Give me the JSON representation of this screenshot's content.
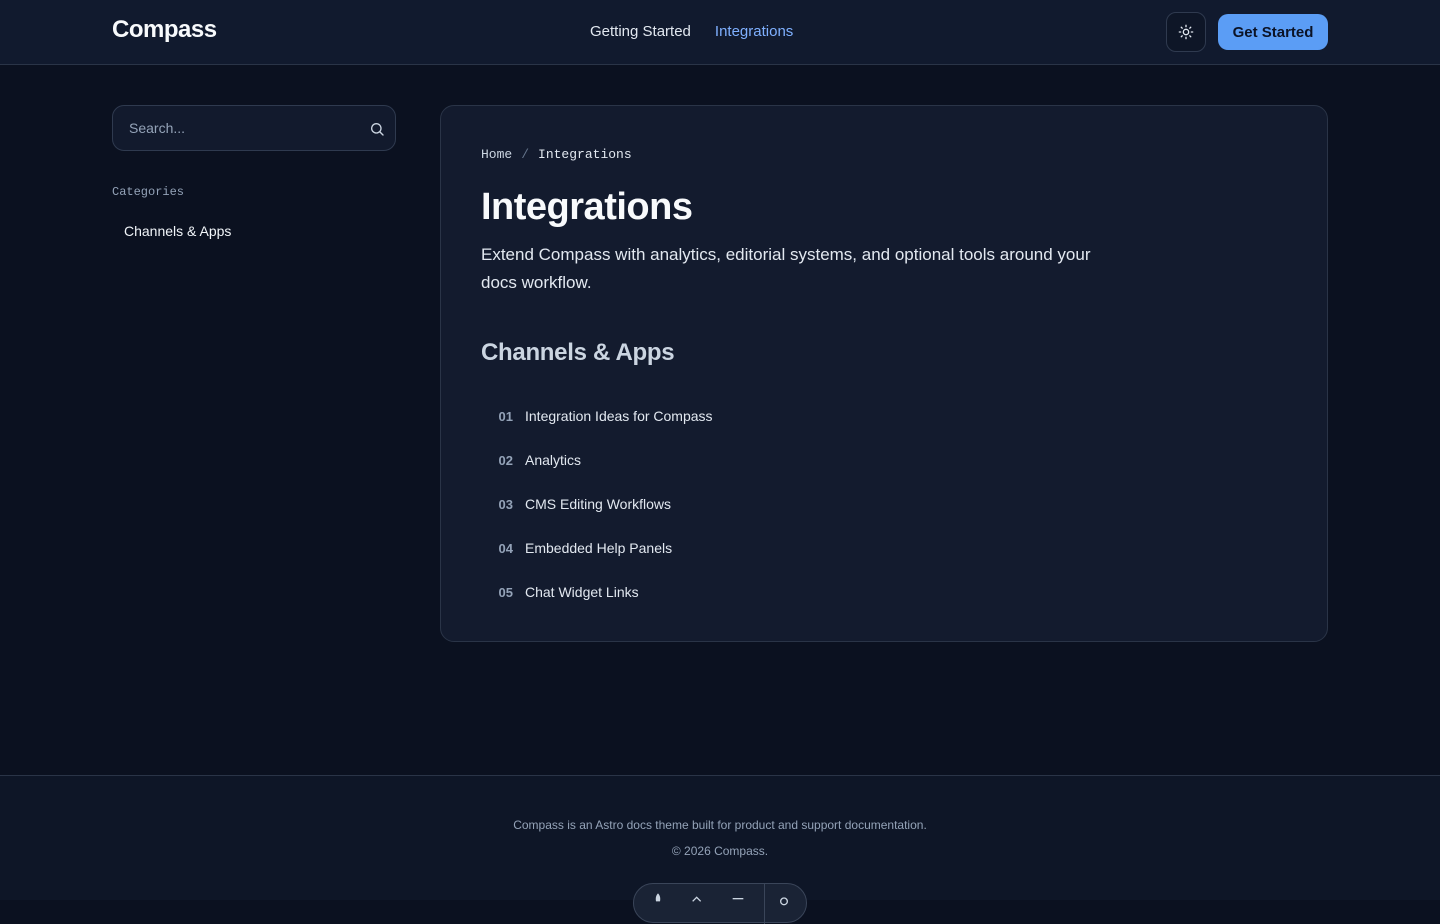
{
  "header": {
    "logo": "Compass",
    "nav": [
      {
        "label": "Getting Started",
        "active": false
      },
      {
        "label": "Integrations",
        "active": true
      }
    ],
    "theme_icon": "sun-icon",
    "cta_label": "Get Started"
  },
  "sidebar": {
    "search_placeholder": "Search...",
    "categories_label": "Categories",
    "category_item": "Channels & Apps"
  },
  "main": {
    "breadcrumb": {
      "home": "Home",
      "separator": "/",
      "current": "Integrations"
    },
    "title": "Integrations",
    "lead": "Extend Compass with analytics, editorial systems, and optional tools around your docs workflow.",
    "section_title": "Channels & Apps",
    "items": [
      {
        "num": "01",
        "label": "Integration Ideas for Compass"
      },
      {
        "num": "02",
        "label": "Analytics"
      },
      {
        "num": "03",
        "label": "CMS Editing Workflows"
      },
      {
        "num": "04",
        "label": "Embedded Help Panels"
      },
      {
        "num": "05",
        "label": "Chat Widget Links"
      }
    ]
  },
  "footer": {
    "description": "Compass is an Astro docs theme built for product and support documentation.",
    "copyright": "© 2026 Compass."
  },
  "colors": {
    "accent": "#5b9df5",
    "nav_active": "#7fb0ff",
    "background": "#0b1120",
    "card": "#131b2e"
  }
}
